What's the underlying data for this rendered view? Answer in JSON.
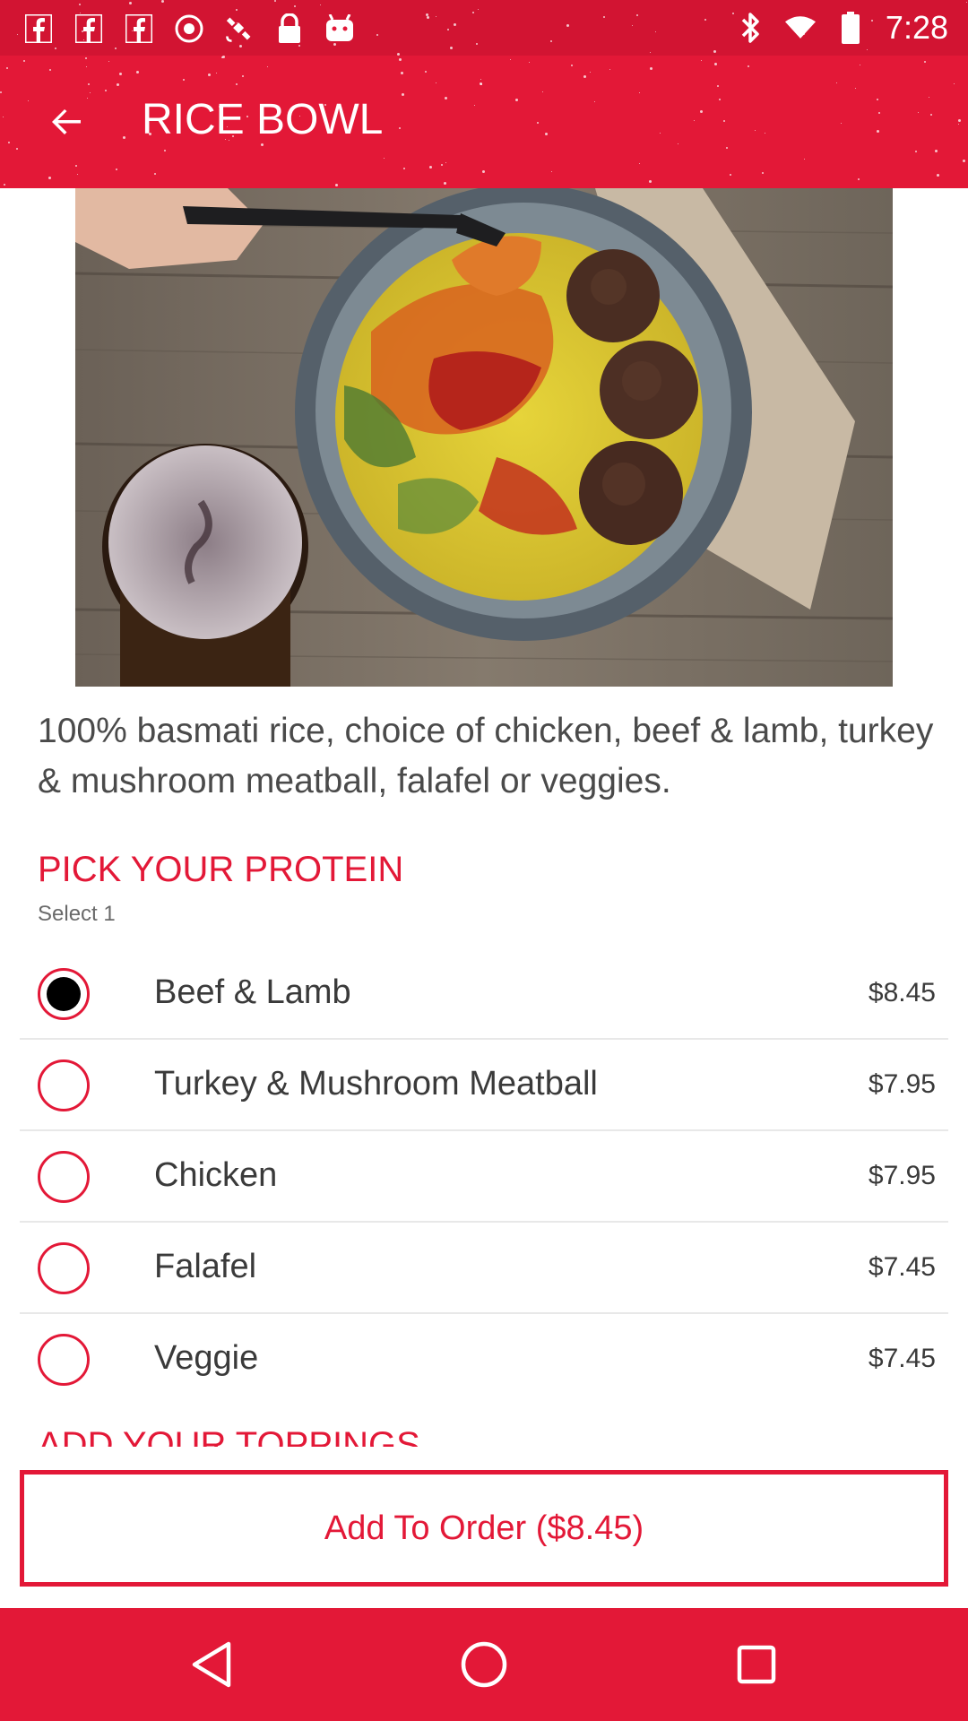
{
  "status_bar": {
    "time": "7:28",
    "icons_left": [
      "facebook-icon",
      "facebook-icon",
      "facebook-icon",
      "fake-gps-icon",
      "satellite-icon",
      "lock-icon",
      "android-icon"
    ],
    "icons_right": [
      "bluetooth-icon",
      "wifi-icon",
      "battery-icon"
    ]
  },
  "app_bar": {
    "title": "RICE BOWL",
    "back_icon": "arrow-back-icon"
  },
  "product": {
    "description": "100% basmati rice, choice of chicken, beef & lamb, turkey & mushroom meatball, falafel or veggies."
  },
  "protein_section": {
    "title": "PICK YOUR PROTEIN",
    "subtitle": "Select 1",
    "options": [
      {
        "label": "Beef & Lamb",
        "price": "$8.45",
        "selected": true
      },
      {
        "label": "Turkey & Mushroom Meatball",
        "price": "$7.95",
        "selected": false
      },
      {
        "label": "Chicken",
        "price": "$7.95",
        "selected": false
      },
      {
        "label": "Falafel",
        "price": "$7.45",
        "selected": false
      },
      {
        "label": "Veggie",
        "price": "$7.45",
        "selected": false
      }
    ]
  },
  "next_section": {
    "title": "ADD YOUR TOPPINGS"
  },
  "footer": {
    "add_button_label": "Add To Order ($8.45)"
  },
  "nav_bar": {
    "buttons": [
      "back-triangle-icon",
      "home-circle-icon",
      "recents-square-icon"
    ]
  },
  "colors": {
    "brand_red": "#e31837",
    "text": "#3a3a3a",
    "radio_checked": "#000000"
  }
}
